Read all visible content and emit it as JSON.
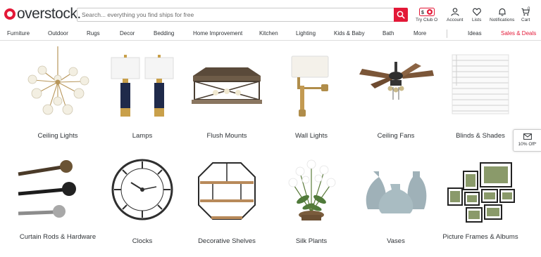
{
  "brand": {
    "logo_text": "overstock.",
    "accent_color": "#e31837"
  },
  "search": {
    "placeholder": "Search... everything you find ships for free"
  },
  "header_icons": [
    {
      "icon": "club-o-icon",
      "label": "Try Club O"
    },
    {
      "icon": "account-icon",
      "label": "Account"
    },
    {
      "icon": "heart-icon",
      "label": "Lists"
    },
    {
      "icon": "bell-icon",
      "label": "Notifications"
    },
    {
      "icon": "cart-icon",
      "label": "Cart",
      "count": "0"
    }
  ],
  "nav": {
    "items": [
      "Furniture",
      "Outdoor",
      "Rugs",
      "Decor",
      "Bedding",
      "Home Improvement",
      "Kitchen",
      "Lighting",
      "Kids & Baby",
      "Bath",
      "More"
    ],
    "ideas": "Ideas",
    "deals": "Sales & Deals"
  },
  "categories": [
    {
      "label": "Ceiling Lights",
      "icon": "ceiling-light-image"
    },
    {
      "label": "Lamps",
      "icon": "lamp-image"
    },
    {
      "label": "Flush Mounts",
      "icon": "flush-mount-image"
    },
    {
      "label": "Wall Lights",
      "icon": "wall-light-image"
    },
    {
      "label": "Ceiling Fans",
      "icon": "ceiling-fan-image"
    },
    {
      "label": "Blinds & Shades",
      "icon": "blinds-image"
    },
    {
      "label": "Curtain Rods & Hardware",
      "icon": "curtain-rod-image"
    },
    {
      "label": "Clocks",
      "icon": "clock-image"
    },
    {
      "label": "Decorative Shelves",
      "icon": "shelf-image"
    },
    {
      "label": "Silk Plants",
      "icon": "silk-plant-image"
    },
    {
      "label": "Vases",
      "icon": "vase-image"
    },
    {
      "label": "Picture Frames & Albums",
      "icon": "picture-frames-image"
    }
  ],
  "side_tab": {
    "icon": "envelope-icon",
    "label": "10% Off*"
  }
}
